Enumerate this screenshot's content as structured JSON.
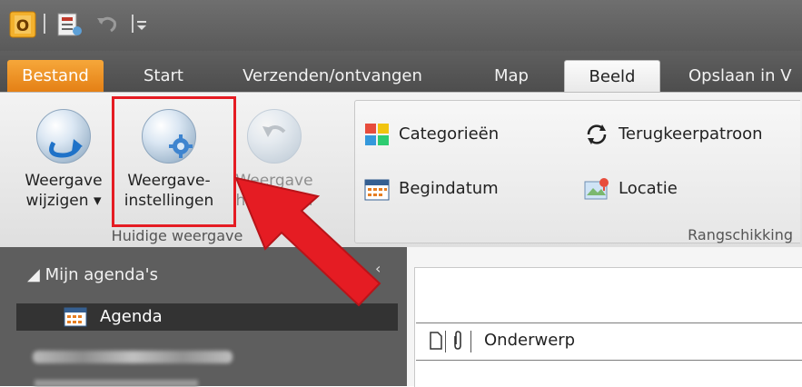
{
  "tabs": [
    "Bestand",
    "Start",
    "Verzenden/ontvangen",
    "Map",
    "Beeld",
    "Opslaan in V"
  ],
  "current_view_group": {
    "label": "Huidige weergave",
    "buttons": [
      {
        "line1": "Weergave",
        "line2": "wijzigen ▾"
      },
      {
        "line1": "Weergave-",
        "line2": "instellingen"
      },
      {
        "line1": "Weergave",
        "line2": "herstellen"
      }
    ]
  },
  "arrangement_group": {
    "label": "Rangschikking",
    "items": [
      "Categorieën",
      "Terugkeerpatroon",
      "Begindatum",
      "Locatie"
    ]
  },
  "nav": {
    "section": "◢ Mijn agenda's",
    "collapse": "‹",
    "item": "Agenda"
  },
  "list": {
    "column": "Onderwerp"
  },
  "colors": {
    "file_tab": "#e47f14",
    "highlight": "#e51c23",
    "arrow": "#e51c23"
  }
}
